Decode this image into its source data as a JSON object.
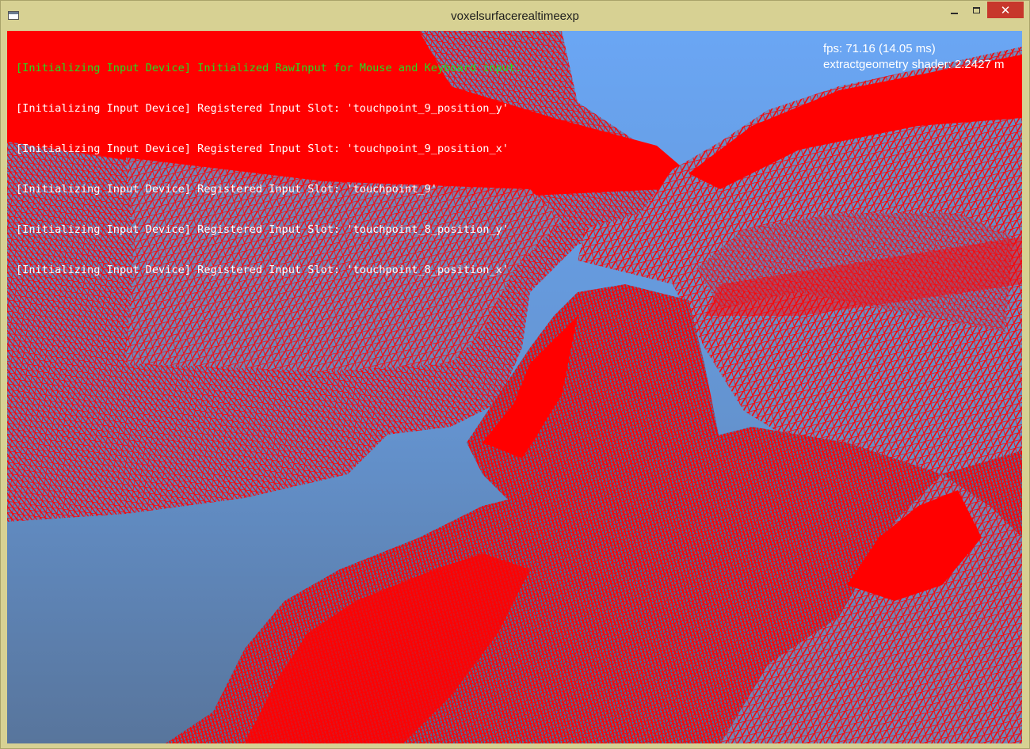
{
  "window": {
    "title": "voxelsurfacerealtimeexp",
    "controls": {
      "minimize": "minimize-icon",
      "maximize": "maximize-icon",
      "close": "close-icon",
      "close_glyph": "✕"
    }
  },
  "console": {
    "lines": [
      "[Initializing Input Device] Initialized RawInput for Mouse and Keyboard input.",
      "[Initializing Input Device] Registered Input Slot: 'touchpoint_9_position_y'",
      "[Initializing Input Device] Registered Input Slot: 'touchpoint_9_position_x'",
      "[Initializing Input Device] Registered Input Slot: 'touchpoint_9'",
      "[Initializing Input Device] Registered Input Slot: 'touchpoint_8_position_y'",
      "[Initializing Input Device] Registered Input Slot: 'touchpoint_8_position_x'"
    ]
  },
  "stats": {
    "fps": "fps: 71.16 (14.05 ms)",
    "shader": "extractgeometry shader: 2.2427 m"
  },
  "colors": {
    "frame": "#d7d193",
    "wireframe": "#ff0000",
    "sky": "#6aa6f4",
    "console_first": "#22dd22",
    "console_rest": "#ffffff"
  }
}
